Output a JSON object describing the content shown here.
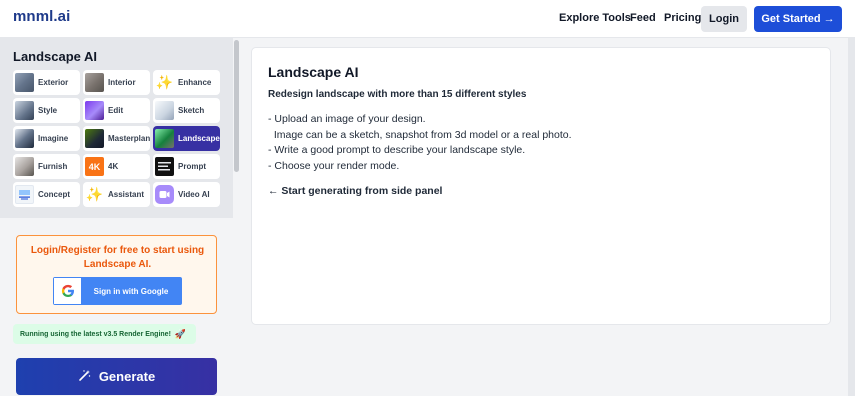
{
  "header": {
    "logo": "mnml.ai",
    "nav": [
      "Explore Tools",
      "Feed",
      "Pricing"
    ],
    "login_label": "Login",
    "get_started_label": "Get Started",
    "get_started_arrow": "→"
  },
  "sidebar": {
    "title": "Landscape AI",
    "tools": [
      {
        "label": "Exterior",
        "icon": "exterior-thumbnail"
      },
      {
        "label": "Interior",
        "icon": "interior-thumbnail"
      },
      {
        "label": "Enhance",
        "icon": "sparkles-icon"
      },
      {
        "label": "Style",
        "icon": "style-thumbnail"
      },
      {
        "label": "Edit",
        "icon": "edit-thumbnail"
      },
      {
        "label": "Sketch",
        "icon": "sketch-thumbnail"
      },
      {
        "label": "Imagine",
        "icon": "imagine-thumbnail"
      },
      {
        "label": "Masterplan",
        "icon": "masterplan-thumbnail"
      },
      {
        "label": "Landscape",
        "icon": "landscape-thumbnail",
        "active": true
      },
      {
        "label": "Furnish",
        "icon": "furnish-thumbnail"
      },
      {
        "label": "4K",
        "icon": "4k-badge",
        "badge": "4K"
      },
      {
        "label": "Prompt",
        "icon": "prompt-thumbnail"
      },
      {
        "label": "Concept",
        "icon": "concept-thumbnail"
      },
      {
        "label": "Assistant",
        "icon": "sparkles-icon"
      },
      {
        "label": "Video AI",
        "icon": "video-icon"
      }
    ],
    "login_prompt": "Login/Register for free to start using Landscape AI.",
    "google_button_label": "Sign in with Google",
    "engine_badge": "Running using the latest v3.5 Render Engine!",
    "generate_label": "Generate"
  },
  "main": {
    "title": "Landscape AI",
    "subtitle": "Redesign landscape with more than 15 different styles",
    "instructions": [
      "- Upload an image of your design.",
      "  Image can be a sketch, snapshot from 3d model or a real photo.",
      "- Write a good prompt to describe your landscape style.",
      "- Choose your render mode."
    ],
    "cta": "← Start generating from side panel"
  },
  "colors": {
    "brand": "#1e3a8a",
    "primary_button": "#1d4ed8",
    "active_tool": "#3730a3",
    "login_accent": "#ea580c",
    "google_blue": "#4285f4"
  }
}
